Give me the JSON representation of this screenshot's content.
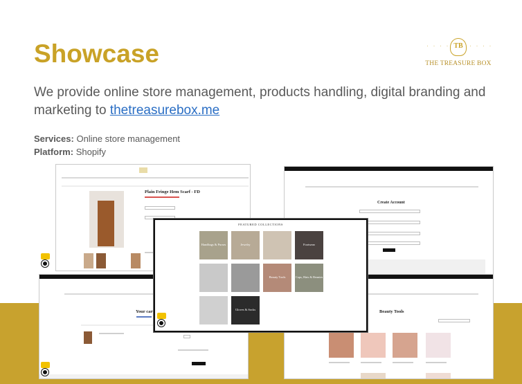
{
  "slide": {
    "title": "Showcase",
    "intro_text": "We provide online store management, products handling, digital branding and marketing to ",
    "intro_link": "thetreasurebox.me",
    "services_label": "Services:",
    "services_value": "Online store management",
    "platform_label": "Platform:",
    "platform_value": "Shopify"
  },
  "logo": {
    "monogram": "TB",
    "name": "THE TREASURE BOX"
  },
  "screenshots": {
    "product_title": "Plain Fringe Hem Scarf - FD",
    "create_account_title": "Create Account",
    "cart_title": "Your cart",
    "beauty_title": "Beauty Tools",
    "collections_title": "FEATURED COLLECTIONS",
    "collection_tiles": [
      "Handbags & Purses",
      "Jewelry",
      "",
      "Footwear",
      "",
      "",
      "Beauty Tools",
      "Caps, Hats & Beanies",
      "",
      "Gloves & Socks"
    ]
  },
  "colors": {
    "title_gold": "#c9a227",
    "band_gold": "#c8a22e",
    "body_text": "#595959",
    "link_blue": "#2a6ec4"
  }
}
